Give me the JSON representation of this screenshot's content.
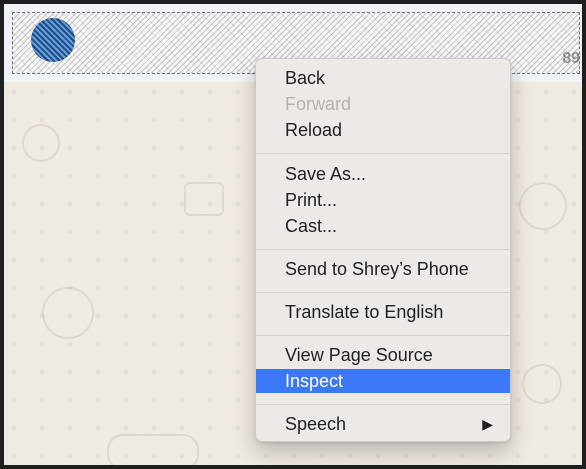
{
  "chat_header": {
    "title": "",
    "status": "",
    "status_tail": "89"
  },
  "context_menu": {
    "items": [
      {
        "label": "Back"
      },
      {
        "label": "Forward",
        "disabled": true
      },
      {
        "label": "Reload"
      },
      {
        "label": "Save As..."
      },
      {
        "label": "Print..."
      },
      {
        "label": "Cast..."
      },
      {
        "label": "Send to Shrey’s Phone"
      },
      {
        "label": "Translate to English"
      },
      {
        "label": "View Page Source"
      },
      {
        "label": "Inspect",
        "selected": true
      },
      {
        "label": "Speech",
        "submenu_icon": "submenu-arrow-icon"
      }
    ]
  },
  "colors": {
    "menu_background": "#ece9e7",
    "selection": "#3b78f6",
    "wallpaper": "#efeae2"
  }
}
